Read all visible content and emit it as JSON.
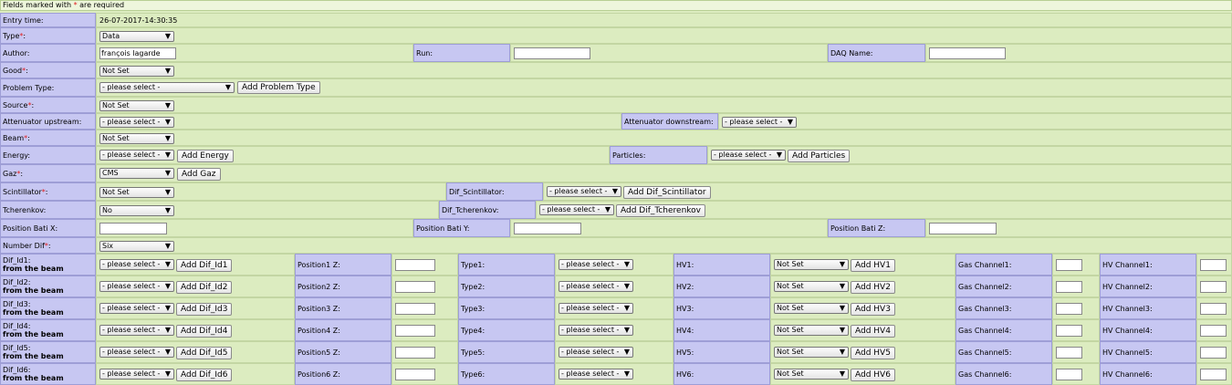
{
  "header": {
    "note_prefix": "Fields marked with ",
    "note_star": "*",
    "note_suffix": " are required"
  },
  "entry_time": {
    "label": "Entry time:",
    "value": "26-07-2017-14:30:35"
  },
  "type": {
    "label": "Type",
    "value": "Data"
  },
  "author": {
    "label": "Author:",
    "value": "françois lagarde"
  },
  "run": {
    "label": "Run:",
    "value": ""
  },
  "daq_name": {
    "label": "DAQ Name:",
    "value": ""
  },
  "good": {
    "label": "Good",
    "value": "Not Set"
  },
  "problem_type": {
    "label": "Problem Type:",
    "value": "- please select -",
    "add": "Add Problem Type"
  },
  "source": {
    "label": "Source",
    "value": "Not Set"
  },
  "attenuator_up": {
    "label": "Attenuator upstream:",
    "value": "- please select -"
  },
  "attenuator_down": {
    "label": "Attenuator downstream:",
    "value": "- please select -"
  },
  "beam": {
    "label": "Beam",
    "value": "Not Set"
  },
  "energy": {
    "label": "Energy:",
    "value": "- please select -",
    "add": "Add Energy"
  },
  "particles": {
    "label": "Particles:",
    "value": "- please select -",
    "add": "Add Particles"
  },
  "gaz": {
    "label": "Gaz",
    "value": "CMS",
    "add": "Add Gaz"
  },
  "scintillator": {
    "label": "Scintillator",
    "value": "Not Set"
  },
  "dif_scintillator": {
    "label": "Dif_Scintillator:",
    "value": "- please select -",
    "add": "Add Dif_Scintillator"
  },
  "tcherenkov": {
    "label": "Tcherenkov:",
    "value": "No"
  },
  "dif_tcherenkov": {
    "label": "Dif_Tcherenkov:",
    "value": "- please select -",
    "add": "Add Dif_Tcherenkov"
  },
  "position_bati": {
    "x_label": "Position Bati X:",
    "y_label": "Position Bati Y:",
    "z_label": "Position Bati Z:",
    "x": "",
    "y": "",
    "z": ""
  },
  "number_dif": {
    "label": "Number Dif",
    "value": "Six"
  },
  "dif_rows": [
    {
      "label": "Dif_Id1:",
      "sub": "from the beam",
      "select": "- please select -",
      "add": "Add Dif_Id1",
      "pos_label": "Position1 Z:",
      "pos": "",
      "type_label": "Type1:",
      "type_value": "- please select -",
      "hv_label": "HV1:",
      "hv_value": "Not Set",
      "hv_add": "Add HV1",
      "gas_label": "Gas Channel1:",
      "gas": "",
      "hvch_label": "HV Channel1:",
      "hvch": ""
    },
    {
      "label": "Dif_Id2:",
      "sub": "from the beam",
      "select": "- please select -",
      "add": "Add Dif_Id2",
      "pos_label": "Position2 Z:",
      "pos": "",
      "type_label": "Type2:",
      "type_value": "- please select -",
      "hv_label": "HV2:",
      "hv_value": "Not Set",
      "hv_add": "Add HV2",
      "gas_label": "Gas Channel2:",
      "gas": "",
      "hvch_label": "HV Channel2:",
      "hvch": ""
    },
    {
      "label": "Dif_Id3:",
      "sub": "from the beam",
      "select": "- please select -",
      "add": "Add Dif_Id3",
      "pos_label": "Position3 Z:",
      "pos": "",
      "type_label": "Type3:",
      "type_value": "- please select -",
      "hv_label": "HV3:",
      "hv_value": "Not Set",
      "hv_add": "Add HV3",
      "gas_label": "Gas Channel3:",
      "gas": "",
      "hvch_label": "HV Channel3:",
      "hvch": ""
    },
    {
      "label": "Dif_Id4:",
      "sub": "from the beam",
      "select": "- please select -",
      "add": "Add Dif_Id4",
      "pos_label": "Position4 Z:",
      "pos": "",
      "type_label": "Type4:",
      "type_value": "- please select -",
      "hv_label": "HV4:",
      "hv_value": "Not Set",
      "hv_add": "Add HV4",
      "gas_label": "Gas Channel4:",
      "gas": "",
      "hvch_label": "HV Channel4:",
      "hvch": ""
    },
    {
      "label": "Dif_Id5:",
      "sub": "from the beam",
      "select": "- please select -",
      "add": "Add Dif_Id5",
      "pos_label": "Position5 Z:",
      "pos": "",
      "type_label": "Type5:",
      "type_value": "- please select -",
      "hv_label": "HV5:",
      "hv_value": "Not Set",
      "hv_add": "Add HV5",
      "gas_label": "Gas Channel5:",
      "gas": "",
      "hvch_label": "HV Channel5:",
      "hvch": ""
    },
    {
      "label": "Dif_Id6:",
      "sub": "from the beam",
      "select": "- please select -",
      "add": "Add Dif_Id6",
      "pos_label": "Position6 Z:",
      "pos": "",
      "type_label": "Type6:",
      "type_value": "- please select -",
      "hv_label": "HV6:",
      "hv_value": "Not Set",
      "hv_add": "Add HV6",
      "gas_label": "Gas Channel6:",
      "gas": "",
      "hvch_label": "HV Channel6:",
      "hvch": ""
    }
  ],
  "icons": {
    "dropdown": "chevron-down-icon"
  },
  "colors": {
    "label_bg": "#c7c7f2",
    "value_bg": "#dcecc0",
    "required": "#e02020"
  }
}
